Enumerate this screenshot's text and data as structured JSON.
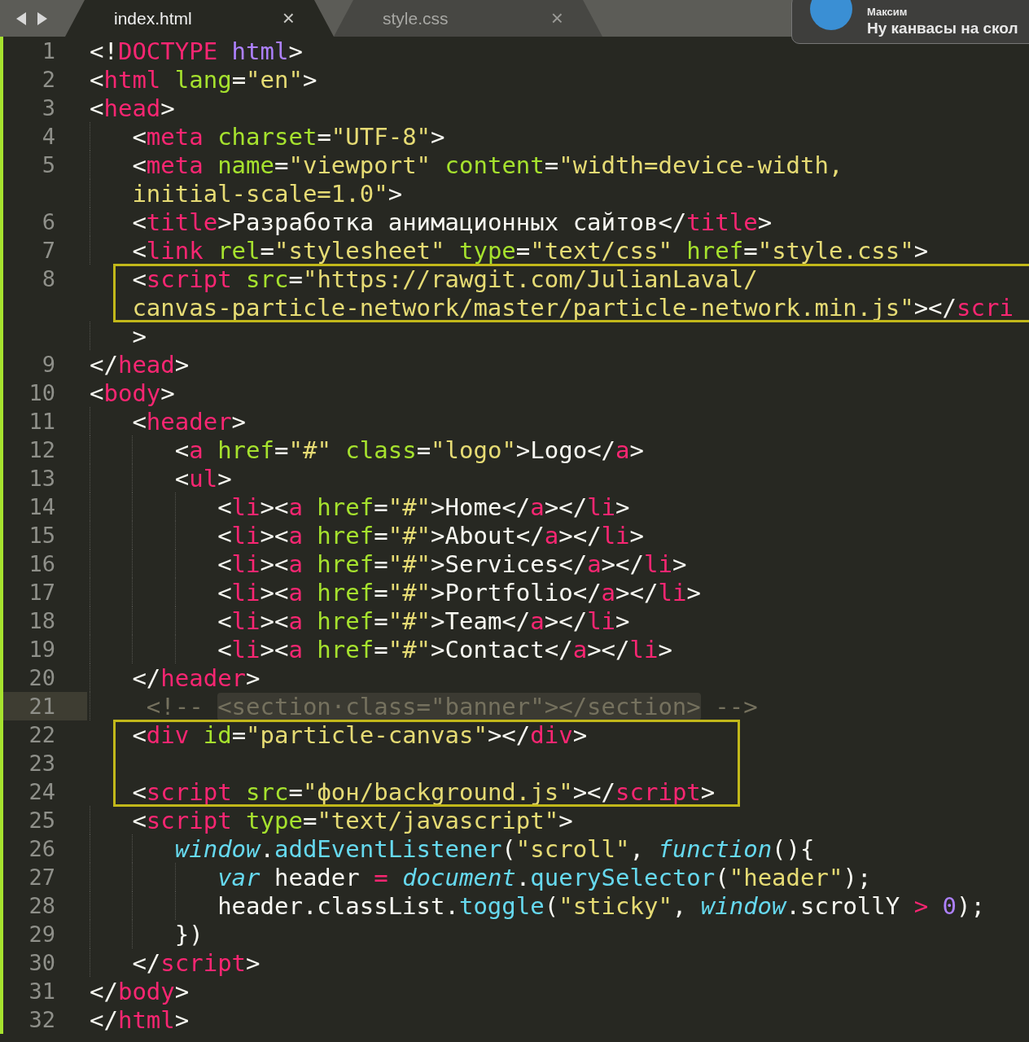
{
  "tabs": [
    {
      "label": "index.html",
      "close": "×",
      "selected": true
    },
    {
      "label": "style.css",
      "close": "×",
      "selected": false
    }
  ],
  "notification": {
    "sender": "Максим",
    "message": "Ну канвасы на скол"
  },
  "lines": [
    {
      "number": "1",
      "rows": [
        {
          "tokens": [
            {
              "text": "<!",
              "kind": "p"
            },
            {
              "text": "DOCTYPE",
              "kind": "tag"
            },
            {
              "text": " html",
              "kind": "num"
            },
            {
              "text": ">",
              "kind": "p"
            }
          ]
        }
      ]
    },
    {
      "number": "2",
      "rows": [
        {
          "tokens": [
            {
              "text": "<",
              "kind": "p"
            },
            {
              "text": "html",
              "kind": "tag"
            },
            {
              "text": " lang",
              "kind": "attr"
            },
            {
              "text": "=",
              "kind": "p"
            },
            {
              "text": "\"en\"",
              "kind": "str"
            },
            {
              "text": ">",
              "kind": "p"
            }
          ]
        }
      ]
    },
    {
      "number": "3",
      "rows": [
        {
          "tokens": [
            {
              "text": "<",
              "kind": "p"
            },
            {
              "text": "head",
              "kind": "tag"
            },
            {
              "text": ">",
              "kind": "p"
            }
          ]
        }
      ],
      "children": [
        {
          "number": "4",
          "rows": [
            {
              "tokens": [
                {
                  "text": "<",
                  "kind": "p"
                },
                {
                  "text": "meta",
                  "kind": "tag"
                },
                {
                  "text": " charset",
                  "kind": "attr"
                },
                {
                  "text": "=",
                  "kind": "p"
                },
                {
                  "text": "\"UTF-8\"",
                  "kind": "str"
                },
                {
                  "text": ">",
                  "kind": "p"
                }
              ]
            }
          ]
        },
        {
          "number": "5",
          "rows": [
            {
              "tokens": [
                {
                  "text": "<",
                  "kind": "p"
                },
                {
                  "text": "meta",
                  "kind": "tag"
                },
                {
                  "text": " name",
                  "kind": "attr"
                },
                {
                  "text": "=",
                  "kind": "p"
                },
                {
                  "text": "\"viewport\"",
                  "kind": "str"
                },
                {
                  "text": " content",
                  "kind": "attr"
                },
                {
                  "text": "=",
                  "kind": "p"
                },
                {
                  "text": "\"width=device-width,",
                  "kind": "str"
                }
              ]
            },
            {
              "tokens": [
                {
                  "text": "initial-scale=1.0\"",
                  "kind": "str"
                },
                {
                  "text": ">",
                  "kind": "p"
                }
              ]
            }
          ]
        },
        {
          "number": "6",
          "rows": [
            {
              "tokens": [
                {
                  "text": "<",
                  "kind": "p"
                },
                {
                  "text": "title",
                  "kind": "tag"
                },
                {
                  "text": ">Разработка анимационных сайтов</",
                  "kind": "p"
                },
                {
                  "text": "title",
                  "kind": "tag"
                },
                {
                  "text": ">",
                  "kind": "p"
                }
              ]
            }
          ]
        },
        {
          "number": "7",
          "rows": [
            {
              "tokens": [
                {
                  "text": "<",
                  "kind": "p"
                },
                {
                  "text": "link",
                  "kind": "tag"
                },
                {
                  "text": " rel",
                  "kind": "attr"
                },
                {
                  "text": "=",
                  "kind": "p"
                },
                {
                  "text": "\"stylesheet\"",
                  "kind": "str"
                },
                {
                  "text": " type",
                  "kind": "attr"
                },
                {
                  "text": "=",
                  "kind": "p"
                },
                {
                  "text": "\"text/css\"",
                  "kind": "str"
                },
                {
                  "text": " href",
                  "kind": "attr"
                },
                {
                  "text": "=",
                  "kind": "p"
                },
                {
                  "text": "\"style.css\"",
                  "kind": "str"
                },
                {
                  "text": ">",
                  "kind": "p"
                }
              ]
            }
          ]
        },
        {
          "number": "8",
          "rows": [
            {
              "boxed": true,
              "tokens": [
                {
                  "text": "<",
                  "kind": "p"
                },
                {
                  "text": "script",
                  "kind": "tag"
                },
                {
                  "text": " src",
                  "kind": "attr"
                },
                {
                  "text": "=",
                  "kind": "p"
                },
                {
                  "text": "\"https://rawgit.com/JulianLaval/",
                  "kind": "str"
                }
              ]
            },
            {
              "boxed": true,
              "tokens": [
                {
                  "text": "canvas-particle-network/master/particle-network.min.js\"",
                  "kind": "str"
                },
                {
                  "text": "></",
                  "kind": "p"
                },
                {
                  "text": "scri",
                  "kind": "tag"
                }
              ]
            },
            {
              "boxed": false,
              "tokens": [
                {
                  "text": ">",
                  "kind": "p"
                }
              ]
            }
          ]
        }
      ]
    },
    {
      "number": "9",
      "rows": [
        {
          "tokens": [
            {
              "text": "</",
              "kind": "p"
            },
            {
              "text": "head",
              "kind": "tag"
            },
            {
              "text": ">",
              "kind": "p"
            }
          ]
        }
      ]
    },
    {
      "number": "10",
      "rows": [
        {
          "tokens": [
            {
              "text": "<",
              "kind": "p"
            },
            {
              "text": "body",
              "kind": "tag"
            },
            {
              "text": ">",
              "kind": "p"
            }
          ]
        }
      ],
      "children": [
        {
          "number": "11",
          "rows": [
            {
              "tokens": [
                {
                  "text": "<",
                  "kind": "p"
                },
                {
                  "text": "header",
                  "kind": "tag"
                },
                {
                  "text": ">",
                  "kind": "p"
                }
              ]
            }
          ],
          "children": [
            {
              "number": "12",
              "rows": [
                {
                  "tokens": [
                    {
                      "text": "<",
                      "kind": "p"
                    },
                    {
                      "text": "a",
                      "kind": "tag"
                    },
                    {
                      "text": " href",
                      "kind": "attr"
                    },
                    {
                      "text": "=",
                      "kind": "p"
                    },
                    {
                      "text": "\"#\"",
                      "kind": "str"
                    },
                    {
                      "text": " class",
                      "kind": "attr"
                    },
                    {
                      "text": "=",
                      "kind": "p"
                    },
                    {
                      "text": "\"logo\"",
                      "kind": "str"
                    },
                    {
                      "text": ">Logo</",
                      "kind": "p"
                    },
                    {
                      "text": "a",
                      "kind": "tag"
                    },
                    {
                      "text": ">",
                      "kind": "p"
                    }
                  ]
                }
              ]
            },
            {
              "number": "13",
              "rows": [
                {
                  "tokens": [
                    {
                      "text": "<",
                      "kind": "p"
                    },
                    {
                      "text": "ul",
                      "kind": "tag"
                    },
                    {
                      "text": ">",
                      "kind": "p"
                    }
                  ]
                }
              ],
              "children": [
                {
                  "number": "14",
                  "rows": [
                    {
                      "tokens": [
                        {
                          "text": "<",
                          "kind": "p"
                        },
                        {
                          "text": "li",
                          "kind": "tag"
                        },
                        {
                          "text": "><",
                          "kind": "p"
                        },
                        {
                          "text": "a",
                          "kind": "tag"
                        },
                        {
                          "text": " href",
                          "kind": "attr"
                        },
                        {
                          "text": "=",
                          "kind": "p"
                        },
                        {
                          "text": "\"#\"",
                          "kind": "str"
                        },
                        {
                          "text": ">Home</",
                          "kind": "p"
                        },
                        {
                          "text": "a",
                          "kind": "tag"
                        },
                        {
                          "text": "></",
                          "kind": "p"
                        },
                        {
                          "text": "li",
                          "kind": "tag"
                        },
                        {
                          "text": ">",
                          "kind": "p"
                        }
                      ]
                    }
                  ]
                },
                {
                  "number": "15",
                  "rows": [
                    {
                      "tokens": [
                        {
                          "text": "<",
                          "kind": "p"
                        },
                        {
                          "text": "li",
                          "kind": "tag"
                        },
                        {
                          "text": "><",
                          "kind": "p"
                        },
                        {
                          "text": "a",
                          "kind": "tag"
                        },
                        {
                          "text": " href",
                          "kind": "attr"
                        },
                        {
                          "text": "=",
                          "kind": "p"
                        },
                        {
                          "text": "\"#\"",
                          "kind": "str"
                        },
                        {
                          "text": ">About</",
                          "kind": "p"
                        },
                        {
                          "text": "a",
                          "kind": "tag"
                        },
                        {
                          "text": "></",
                          "kind": "p"
                        },
                        {
                          "text": "li",
                          "kind": "tag"
                        },
                        {
                          "text": ">",
                          "kind": "p"
                        }
                      ]
                    }
                  ]
                },
                {
                  "number": "16",
                  "rows": [
                    {
                      "tokens": [
                        {
                          "text": "<",
                          "kind": "p"
                        },
                        {
                          "text": "li",
                          "kind": "tag"
                        },
                        {
                          "text": "><",
                          "kind": "p"
                        },
                        {
                          "text": "a",
                          "kind": "tag"
                        },
                        {
                          "text": " href",
                          "kind": "attr"
                        },
                        {
                          "text": "=",
                          "kind": "p"
                        },
                        {
                          "text": "\"#\"",
                          "kind": "str"
                        },
                        {
                          "text": ">Services</",
                          "kind": "p"
                        },
                        {
                          "text": "a",
                          "kind": "tag"
                        },
                        {
                          "text": "></",
                          "kind": "p"
                        },
                        {
                          "text": "li",
                          "kind": "tag"
                        },
                        {
                          "text": ">",
                          "kind": "p"
                        }
                      ]
                    }
                  ]
                },
                {
                  "number": "17",
                  "rows": [
                    {
                      "tokens": [
                        {
                          "text": "<",
                          "kind": "p"
                        },
                        {
                          "text": "li",
                          "kind": "tag"
                        },
                        {
                          "text": "><",
                          "kind": "p"
                        },
                        {
                          "text": "a",
                          "kind": "tag"
                        },
                        {
                          "text": " href",
                          "kind": "attr"
                        },
                        {
                          "text": "=",
                          "kind": "p"
                        },
                        {
                          "text": "\"#\"",
                          "kind": "str"
                        },
                        {
                          "text": ">Portfolio</",
                          "kind": "p"
                        },
                        {
                          "text": "a",
                          "kind": "tag"
                        },
                        {
                          "text": "></",
                          "kind": "p"
                        },
                        {
                          "text": "li",
                          "kind": "tag"
                        },
                        {
                          "text": ">",
                          "kind": "p"
                        }
                      ]
                    }
                  ]
                },
                {
                  "number": "18",
                  "rows": [
                    {
                      "tokens": [
                        {
                          "text": "<",
                          "kind": "p"
                        },
                        {
                          "text": "li",
                          "kind": "tag"
                        },
                        {
                          "text": "><",
                          "kind": "p"
                        },
                        {
                          "text": "a",
                          "kind": "tag"
                        },
                        {
                          "text": " href",
                          "kind": "attr"
                        },
                        {
                          "text": "=",
                          "kind": "p"
                        },
                        {
                          "text": "\"#\"",
                          "kind": "str"
                        },
                        {
                          "text": ">Team</",
                          "kind": "p"
                        },
                        {
                          "text": "a",
                          "kind": "tag"
                        },
                        {
                          "text": "></",
                          "kind": "p"
                        },
                        {
                          "text": "li",
                          "kind": "tag"
                        },
                        {
                          "text": ">",
                          "kind": "p"
                        }
                      ]
                    }
                  ]
                },
                {
                  "number": "19",
                  "rows": [
                    {
                      "tokens": [
                        {
                          "text": "<",
                          "kind": "p"
                        },
                        {
                          "text": "li",
                          "kind": "tag"
                        },
                        {
                          "text": "><",
                          "kind": "p"
                        },
                        {
                          "text": "a",
                          "kind": "tag"
                        },
                        {
                          "text": " href",
                          "kind": "attr"
                        },
                        {
                          "text": "=",
                          "kind": "p"
                        },
                        {
                          "text": "\"#\"",
                          "kind": "str"
                        },
                        {
                          "text": ">Contact</",
                          "kind": "p"
                        },
                        {
                          "text": "a",
                          "kind": "tag"
                        },
                        {
                          "text": "></",
                          "kind": "p"
                        },
                        {
                          "text": "li",
                          "kind": "tag"
                        },
                        {
                          "text": ">",
                          "kind": "p"
                        }
                      ]
                    }
                  ]
                }
              ]
            }
          ]
        },
        {
          "number": "20",
          "rows": [
            {
              "tokens": [
                {
                  "text": "</",
                  "kind": "p"
                },
                {
                  "text": "header",
                  "kind": "tag"
                },
                {
                  "text": ">",
                  "kind": "p"
                }
              ]
            }
          ]
        },
        {
          "number": "21",
          "current": true,
          "rows": [
            {
              "tokens": [
                {
                  "text": " <!-- ",
                  "kind": "cmt"
                },
                {
                  "text": "<section·class=\"banner\"></section>",
                  "kind": "sel"
                },
                {
                  "text": " -->",
                  "kind": "cmt"
                }
              ]
            }
          ]
        },
        {
          "number": "22",
          "rows": [
            {
              "boxed": true,
              "tokens": [
                {
                  "text": "<",
                  "kind": "p"
                },
                {
                  "text": "div",
                  "kind": "tag"
                },
                {
                  "text": " id",
                  "kind": "attr"
                },
                {
                  "text": "=",
                  "kind": "p"
                },
                {
                  "text": "\"particle-canvas\"",
                  "kind": "str"
                },
                {
                  "text": "></",
                  "kind": "p"
                },
                {
                  "text": "div",
                  "kind": "tag"
                },
                {
                  "text": ">",
                  "kind": "p"
                }
              ]
            }
          ]
        },
        {
          "number": "23",
          "rows": [
            {
              "boxed": true,
              "tokens": []
            }
          ]
        },
        {
          "number": "24",
          "rows": [
            {
              "boxed": true,
              "tokens": [
                {
                  "text": "<",
                  "kind": "p"
                },
                {
                  "text": "script",
                  "kind": "tag"
                },
                {
                  "text": " src",
                  "kind": "attr"
                },
                {
                  "text": "=",
                  "kind": "p"
                },
                {
                  "text": "\"фон/background.js\"",
                  "kind": "str"
                },
                {
                  "text": "></",
                  "kind": "p"
                },
                {
                  "text": "script",
                  "kind": "tag"
                },
                {
                  "text": ">",
                  "kind": "p"
                }
              ]
            }
          ]
        },
        {
          "number": "25",
          "rows": [
            {
              "tokens": [
                {
                  "text": "<",
                  "kind": "p"
                },
                {
                  "text": "script",
                  "kind": "tag"
                },
                {
                  "text": " type",
                  "kind": "attr"
                },
                {
                  "text": "=",
                  "kind": "p"
                },
                {
                  "text": "\"text/javascript\"",
                  "kind": "str"
                },
                {
                  "text": ">",
                  "kind": "p"
                }
              ]
            }
          ],
          "children": [
            {
              "number": "26",
              "rows": [
                {
                  "tokens": [
                    {
                      "text": "window",
                      "kind": "kw"
                    },
                    {
                      "text": ".",
                      "kind": "p"
                    },
                    {
                      "text": "addEventListener",
                      "kind": "fn"
                    },
                    {
                      "text": "(",
                      "kind": "p"
                    },
                    {
                      "text": "\"scroll\"",
                      "kind": "str"
                    },
                    {
                      "text": ", ",
                      "kind": "p"
                    },
                    {
                      "text": "function",
                      "kind": "kw"
                    },
                    {
                      "text": "(){",
                      "kind": "p"
                    }
                  ]
                }
              ],
              "children": [
                {
                  "number": "27",
                  "rows": [
                    {
                      "tokens": [
                        {
                          "text": "var",
                          "kind": "kw"
                        },
                        {
                          "text": " header ",
                          "kind": "p"
                        },
                        {
                          "text": "=",
                          "kind": "op"
                        },
                        {
                          "text": " document",
                          "kind": "kw"
                        },
                        {
                          "text": ".",
                          "kind": "p"
                        },
                        {
                          "text": "querySelector",
                          "kind": "fn"
                        },
                        {
                          "text": "(",
                          "kind": "p"
                        },
                        {
                          "text": "\"header\"",
                          "kind": "str"
                        },
                        {
                          "text": ");",
                          "kind": "p"
                        }
                      ]
                    }
                  ]
                },
                {
                  "number": "28",
                  "rows": [
                    {
                      "tokens": [
                        {
                          "text": "header.classList.",
                          "kind": "p"
                        },
                        {
                          "text": "toggle",
                          "kind": "fn"
                        },
                        {
                          "text": "(",
                          "kind": "p"
                        },
                        {
                          "text": "\"sticky\"",
                          "kind": "str"
                        },
                        {
                          "text": ", ",
                          "kind": "p"
                        },
                        {
                          "text": "window",
                          "kind": "kw"
                        },
                        {
                          "text": ".scrollY ",
                          "kind": "p"
                        },
                        {
                          "text": ">",
                          "kind": "op"
                        },
                        {
                          "text": " 0",
                          "kind": "num"
                        },
                        {
                          "text": ");",
                          "kind": "p"
                        }
                      ]
                    }
                  ]
                }
              ]
            },
            {
              "number": "29",
              "rows": [
                {
                  "tokens": [
                    {
                      "text": "})",
                      "kind": "p"
                    }
                  ]
                }
              ]
            }
          ]
        },
        {
          "number": "30",
          "rows": [
            {
              "tokens": [
                {
                  "text": "</",
                  "kind": "p"
                },
                {
                  "text": "script",
                  "kind": "tag"
                },
                {
                  "text": ">",
                  "kind": "p"
                }
              ]
            }
          ]
        }
      ]
    },
    {
      "number": "31",
      "rows": [
        {
          "tokens": [
            {
              "text": "</",
              "kind": "p"
            },
            {
              "text": "body",
              "kind": "tag"
            },
            {
              "text": ">",
              "kind": "p"
            }
          ]
        }
      ]
    },
    {
      "number": "32",
      "rows": [
        {
          "tokens": [
            {
              "text": "</",
              "kind": "p"
            },
            {
              "text": "html",
              "kind": "tag"
            },
            {
              "text": ">",
              "kind": "p"
            }
          ]
        }
      ]
    }
  ]
}
